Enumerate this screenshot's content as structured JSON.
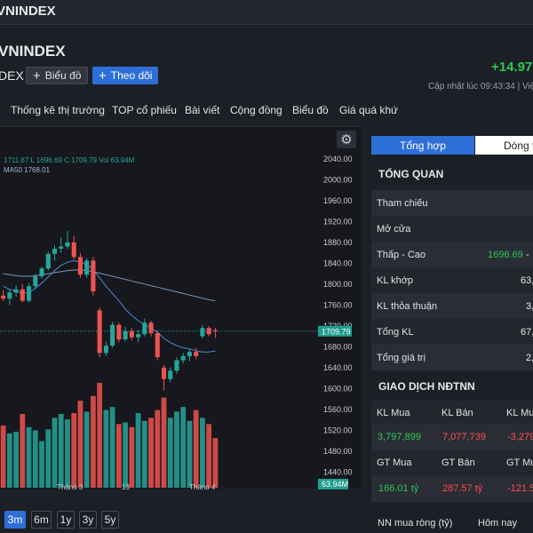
{
  "topbar": {
    "title": "VNINDEX"
  },
  "header": {
    "title": "VNINDEX",
    "code": "DEX",
    "chart_button": "Biểu đồ",
    "follow_button": "Theo dõi",
    "change": "+14.97",
    "updated": "Cập nhật lúc  09:43:34 | Việt"
  },
  "nav": {
    "items": [
      "Thống kê thị trường",
      "TOP cổ phiếu",
      "Bài viết",
      "Cộng đồng",
      "Biểu đồ",
      "Giá quá khứ"
    ]
  },
  "chart": {
    "legend_ohlc": "1711.67  L  1696.69  C  1709.79  Vol  63.94M",
    "legend_ma": "MA50  1768.01",
    "price_ticks": [
      "2040.00",
      "2000.00",
      "1960.00",
      "1920.00",
      "1880.00",
      "1840.00",
      "1800.00",
      "1760.00",
      "1720.00",
      "1680.00",
      "1640.00",
      "1600.00",
      "1560.00",
      "1520.00",
      "1480.00",
      "1440.00"
    ],
    "last_price": "1709.79",
    "last_volume": "63.94M",
    "x_labels": [
      "Tháng 3",
      "13",
      "Tháng 4"
    ],
    "colors": {
      "up": "#26a69a",
      "down": "#ef5350",
      "ma_short": "#4f88d6",
      "ma_long": "#7e97b3"
    }
  },
  "chart_data": {
    "type": "candlestick",
    "ylim": [
      1420,
      2050
    ],
    "x_labels": [
      "Tháng 3",
      "13",
      "Tháng 4"
    ],
    "candles": [
      {
        "o": 1778,
        "h": 1788,
        "l": 1768,
        "c": 1772
      },
      {
        "o": 1772,
        "h": 1790,
        "l": 1760,
        "c": 1784
      },
      {
        "o": 1784,
        "h": 1798,
        "l": 1776,
        "c": 1790
      },
      {
        "o": 1790,
        "h": 1800,
        "l": 1765,
        "c": 1768
      },
      {
        "o": 1768,
        "h": 1802,
        "l": 1765,
        "c": 1796
      },
      {
        "o": 1796,
        "h": 1820,
        "l": 1790,
        "c": 1815
      },
      {
        "o": 1815,
        "h": 1834,
        "l": 1810,
        "c": 1830
      },
      {
        "o": 1830,
        "h": 1862,
        "l": 1826,
        "c": 1858
      },
      {
        "o": 1858,
        "h": 1874,
        "l": 1845,
        "c": 1868
      },
      {
        "o": 1868,
        "h": 1890,
        "l": 1860,
        "c": 1872
      },
      {
        "o": 1872,
        "h": 1902,
        "l": 1868,
        "c": 1880
      },
      {
        "o": 1880,
        "h": 1892,
        "l": 1848,
        "c": 1852
      },
      {
        "o": 1852,
        "h": 1860,
        "l": 1812,
        "c": 1818
      },
      {
        "o": 1818,
        "h": 1850,
        "l": 1812,
        "c": 1845
      },
      {
        "o": 1845,
        "h": 1852,
        "l": 1778,
        "c": 1786
      },
      {
        "o": 1750,
        "h": 1755,
        "l": 1660,
        "c": 1668
      },
      {
        "o": 1668,
        "h": 1690,
        "l": 1662,
        "c": 1682
      },
      {
        "o": 1682,
        "h": 1728,
        "l": 1678,
        "c": 1722
      },
      {
        "o": 1722,
        "h": 1726,
        "l": 1688,
        "c": 1694
      },
      {
        "o": 1694,
        "h": 1718,
        "l": 1690,
        "c": 1710
      },
      {
        "o": 1710,
        "h": 1716,
        "l": 1692,
        "c": 1698
      },
      {
        "o": 1698,
        "h": 1712,
        "l": 1688,
        "c": 1704
      },
      {
        "o": 1704,
        "h": 1734,
        "l": 1700,
        "c": 1726
      },
      {
        "o": 1726,
        "h": 1730,
        "l": 1700,
        "c": 1706
      },
      {
        "o": 1706,
        "h": 1712,
        "l": 1654,
        "c": 1660
      },
      {
        "o": 1640,
        "h": 1645,
        "l": 1596,
        "c": 1618
      },
      {
        "o": 1618,
        "h": 1640,
        "l": 1612,
        "c": 1634
      },
      {
        "o": 1634,
        "h": 1660,
        "l": 1628,
        "c": 1654
      },
      {
        "o": 1654,
        "h": 1668,
        "l": 1648,
        "c": 1662
      },
      {
        "o": 1662,
        "h": 1676,
        "l": 1652,
        "c": 1670
      },
      {
        "o": 1670,
        "h": 1678,
        "l": 1656,
        "c": 1662
      },
      {
        "o": 1700,
        "h": 1722,
        "l": 1696,
        "c": 1716
      },
      {
        "o": 1716,
        "h": 1720,
        "l": 1700,
        "c": 1704
      },
      {
        "o": 1711.67,
        "h": 1716,
        "l": 1696.69,
        "c": 1709.79
      }
    ],
    "volumes_m": [
      80,
      70,
      72,
      95,
      78,
      74,
      60,
      75,
      90,
      95,
      88,
      96,
      112,
      98,
      118,
      135,
      100,
      104,
      82,
      84,
      78,
      96,
      86,
      90,
      100,
      116,
      90,
      98,
      104,
      86,
      100,
      90,
      82,
      63.94
    ],
    "ma20": [
      1796,
      1790,
      1786,
      1782,
      1784,
      1792,
      1802,
      1814,
      1826,
      1836,
      1842,
      1845,
      1842,
      1838,
      1828,
      1812,
      1796,
      1782,
      1768,
      1752,
      1740,
      1730,
      1722,
      1716,
      1708,
      1696,
      1688,
      1682,
      1678,
      1676,
      1672,
      1670,
      1670,
      1672
    ],
    "ma50": [
      1820,
      1818,
      1816,
      1815,
      1815,
      1816,
      1818,
      1820,
      1822,
      1824,
      1826,
      1827,
      1827,
      1826,
      1824,
      1821,
      1818,
      1815,
      1812,
      1809,
      1806,
      1803,
      1800,
      1797,
      1794,
      1791,
      1788,
      1785,
      1782,
      1779,
      1776,
      1773,
      1770,
      1768.01
    ]
  },
  "ranges": [
    "3m",
    "6m",
    "1y",
    "3y",
    "5y"
  ],
  "right_panel": {
    "tabs": [
      "Tổng hợp",
      "Dòng t"
    ],
    "overview_title": "TỔNG QUAN",
    "rows": [
      {
        "label": "Tham chiếu",
        "value": ""
      },
      {
        "label": "Mở cửa",
        "value": ""
      },
      {
        "label": "Thấp - Cao",
        "value": "1696.69"
      },
      {
        "label": "KL khớp",
        "value": "63,"
      },
      {
        "label": "KL thỏa thuận",
        "value": "3,"
      },
      {
        "label": "Tổng KL",
        "value": "67,"
      },
      {
        "label": "Tổng giá trị",
        "value": "2,"
      }
    ],
    "foreign_title": "GIAO DỊCH NĐTNN",
    "vol_headers": [
      "KL Mua",
      "KL Bán",
      "KL Mu"
    ],
    "vol_values": [
      "3,797,899",
      "7,077,739",
      "-3,279"
    ],
    "val_headers": [
      "GT Mua",
      "GT Bán",
      "GT Mu"
    ],
    "val_values": [
      "166.01 tỷ",
      "287.57 tỷ",
      "-121.5"
    ],
    "bottom_left": "NN mua ròng (tỷ)",
    "bottom_right": "Hôm nay"
  }
}
